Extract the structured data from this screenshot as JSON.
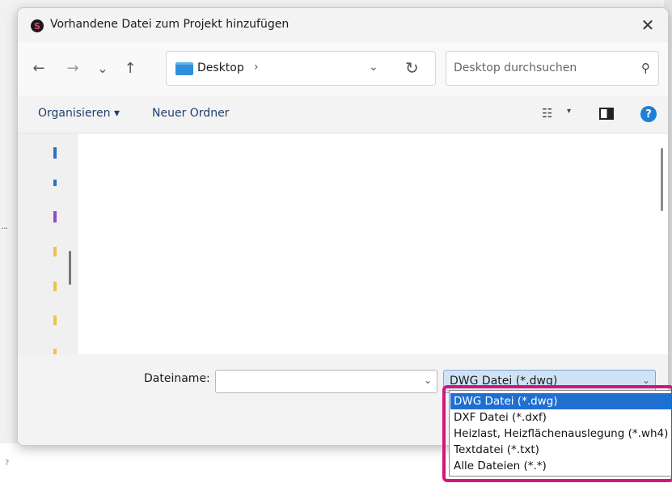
{
  "dialog": {
    "title": "Vorhandene Datei zum Projekt hinzufügen",
    "app_icon_letter": "S",
    "close_glyph": "✕"
  },
  "navigation": {
    "back_glyph": "←",
    "forward_glyph": "→",
    "recent_glyph": "⌄",
    "up_glyph": "↑",
    "address_text": "Desktop",
    "address_separator": "›",
    "address_dropdown_glyph": "⌄",
    "refresh_glyph": "↻",
    "search_placeholder": "Desktop durchsuchen",
    "search_glyph": "⚲"
  },
  "toolbar": {
    "organize_label": "Organisieren ▾",
    "new_folder_label": "Neuer Ordner",
    "view_glyph": "☷",
    "view_dropdown_glyph": "▾",
    "help_glyph": "?"
  },
  "filename": {
    "label": "Dateiname:",
    "value": "",
    "dropdown_glyph": "⌄"
  },
  "filetype": {
    "selected": "DWG Datei (*.dwg)",
    "dropdown_glyph": "⌄",
    "options": [
      "DWG Datei (*.dwg)",
      "DXF Datei (*.dxf)",
      "Heizlast, Heizflächenauslegung (*.wh4)",
      "Textdatei (*.txt)",
      "Alle Dateien (*.*)"
    ]
  },
  "colors": {
    "accent": "#1f6fd1",
    "highlight_border": "#d6157c",
    "select_background": "#cfe3f5"
  },
  "background": {
    "dots": "...",
    "edge_char": "?"
  }
}
